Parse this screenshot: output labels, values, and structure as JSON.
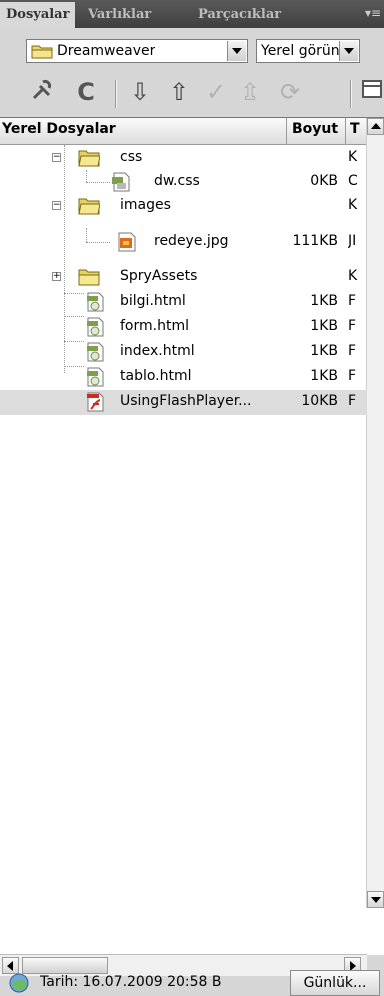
{
  "tabs": [
    {
      "label": "Dosyalar",
      "active": true
    },
    {
      "label": "Varlıklar",
      "active": false
    },
    {
      "label": "Parçacıklar",
      "active": false
    }
  ],
  "site_select": {
    "value": "Dreamweaver"
  },
  "view_select": {
    "value": "Yerel görünüm"
  },
  "toolbar_icons": [
    "connect-icon",
    "refresh-icon",
    "get-icon",
    "put-icon",
    "check-out-icon",
    "check-in-icon",
    "synchronize-icon",
    "expand-icon"
  ],
  "header": {
    "name": "Yerel Dosyalar",
    "size": "Boyut",
    "type": "T"
  },
  "files": [
    {
      "name": "css",
      "size": "",
      "type": "K",
      "icon": "folder-icon",
      "expanded": true
    },
    {
      "name": "dw.css",
      "size": "0KB",
      "type": "C",
      "icon": "css-file-icon"
    },
    {
      "name": "images",
      "size": "",
      "type": "K",
      "icon": "folder-icon",
      "expanded": true
    },
    {
      "name": "redeye.jpg",
      "size": "111KB",
      "type": "JI",
      "icon": "jpg-file-icon"
    },
    {
      "name": "SpryAssets",
      "size": "",
      "type": "K",
      "icon": "folder-icon",
      "expanded": false
    },
    {
      "name": "bilgi.html",
      "size": "1KB",
      "type": "F",
      "icon": "html-file-icon"
    },
    {
      "name": "form.html",
      "size": "1KB",
      "type": "F",
      "icon": "html-file-icon"
    },
    {
      "name": "index.html",
      "size": "1KB",
      "type": "F",
      "icon": "html-file-icon"
    },
    {
      "name": "tablo.html",
      "size": "1KB",
      "type": "F",
      "icon": "html-file-icon"
    },
    {
      "name": "UsingFlashPlayer...",
      "size": "10KB",
      "type": "F",
      "icon": "pdf-file-icon",
      "selected": true
    }
  ],
  "status": {
    "text": "Tarih: 16.07.2009 20:58 B",
    "log_button": "Günlük..."
  },
  "colors": {
    "tab_bg": "#4a4a4a",
    "panel_bg": "#d6d6d6",
    "selected_row": "#dcdcdc"
  }
}
